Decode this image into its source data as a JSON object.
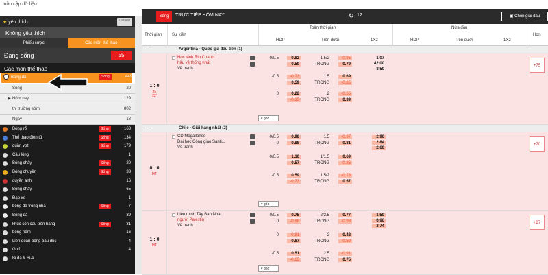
{
  "topbar": {
    "text": "luồn cập dữ liệu."
  },
  "sidebar": {
    "favorites": "yêu thích",
    "thong_button": "Thống kê",
    "no_favorites": "Không yêu thích",
    "tabs": [
      "Phiếu cược",
      "Các môn thể thao"
    ],
    "live_label": "Đang sống",
    "live_count": "55",
    "sports_header": "Các môn thể thao",
    "selected": {
      "label": "Bóng đá",
      "badge": "Sống",
      "count": "449"
    },
    "submenu": [
      {
        "label": "Sống",
        "count": "20"
      },
      {
        "label": "Hôm nay",
        "count": "129"
      },
      {
        "label": "thị trường sớm",
        "count": "802"
      },
      {
        "label": "Ngay",
        "count": "18"
      }
    ],
    "sports": [
      {
        "label": "Bóng rổ",
        "badge": "Sống",
        "count": "163",
        "color": "#e07b27"
      },
      {
        "label": "Thể thao điện tử",
        "badge": "Sống",
        "count": "134",
        "color": "#4a7bd6"
      },
      {
        "label": "quần vợt",
        "badge": "Sống",
        "count": "179",
        "color": "#c7d63a"
      },
      {
        "label": "Cầu lông",
        "badge": "",
        "count": "1",
        "color": "#ddd"
      },
      {
        "label": "Bóng chày",
        "badge": "Sống",
        "count": "20",
        "color": "#ddd"
      },
      {
        "label": "Bóng chuyền",
        "badge": "Sống",
        "count": "33",
        "color": "#e8b020"
      },
      {
        "label": "quyền anh",
        "badge": "",
        "count": "16",
        "color": "#c33"
      },
      {
        "label": "Bóng chày",
        "badge": "",
        "count": "65",
        "color": "#ddd"
      },
      {
        "label": "Đạp xe",
        "badge": "",
        "count": "1",
        "color": "#ddd"
      },
      {
        "label": "bóng đá trong nhà",
        "badge": "Sống",
        "count": "7",
        "color": "#eee"
      },
      {
        "label": "Bóng đá",
        "badge": "",
        "count": "39",
        "color": "#eee"
      },
      {
        "label": "khúc côn cầu trên băng",
        "badge": "Sống",
        "count": "31",
        "color": "#ddd"
      },
      {
        "label": "bóng ném",
        "badge": "",
        "count": "16",
        "color": "#ddd"
      },
      {
        "label": "Liên đoàn bóng bầu dục",
        "badge": "",
        "count": "4",
        "color": "#ddd"
      },
      {
        "label": "Golf",
        "badge": "",
        "count": "4",
        "color": "#ddd"
      },
      {
        "label": "Bi da & Bi-a",
        "badge": "",
        "count": "",
        "color": "#ddd"
      }
    ]
  },
  "main": {
    "header": {
      "live": "Sống",
      "title": "TRỰC TIẾP HÔM NAY",
      "count": "12",
      "pick": "Chọn giải đấu"
    },
    "columns": {
      "time": "Thời gian",
      "event": "Sự kiện",
      "full": "Toàn thời gian",
      "half": "Nửa đầu",
      "more": "Hơn",
      "hdp": "HDP",
      "ou": "Trên dưới",
      "x12": "1X2",
      "hdp2": "HDP",
      "ou2": "Trên dưới",
      "x122": "1X2"
    },
    "leagues": [
      {
        "name": "Argentina - Quốc gia đấu tiên (1)"
      },
      {
        "name": "Chile - Giải hạng nhất (2)"
      }
    ],
    "matches": [
      {
        "score": "1 : 0",
        "status": "2h",
        "status2": "22'",
        "home": "Học sinh Rio Cuarto",
        "away": "hậu vệ thống nhất",
        "draw": "Về tranh",
        "more": "+75",
        "goc": "góc",
        "rows": [
          {
            "hdp": "-0/0.5",
            "h1": "0.82",
            "h2": "0.59",
            "ou": "1.5/2",
            "ou2": "TRONG",
            "o1": "-0.95",
            "o2": "0.79",
            "x1": "1.07",
            "x2": "42.00",
            "x3": "8.50"
          },
          {
            "hdp": "-0.5",
            "h1": "-0.73",
            "h2": "0.59",
            "ou": "1.5",
            "ou2": "TRONG",
            "o1": "0.69",
            "o2": "-0.85"
          },
          {
            "hdp": "0",
            "h1": "0.22",
            "h2": "-0.35",
            "ou": "2",
            "ou2": "TRONG",
            "o1": "-0.55",
            "o2": "0.39"
          }
        ]
      },
      {
        "score": "0 : 0",
        "status": "HT",
        "status2": "",
        "home": "CD Magallanes",
        "away": "Đại học Công giáo Santi...",
        "draw": "Về tranh",
        "more": "+70",
        "goc": "góc",
        "rows": [
          {
            "hdp": "-0/0.5",
            "hdp_b": "0",
            "h1": "0.98",
            "h2": "0.88",
            "ou": "1.5",
            "ou2": "TRONG",
            "o1": "-0.97",
            "o2": "0.81",
            "x1": "2.96",
            "x2": "2.84",
            "x3": "2.60"
          },
          {
            "hdp": "-0/0.5",
            "h1": "1.10",
            "h2": "0.57",
            "ou": "1/1.5",
            "ou2": "TRONG",
            "o1": "0.69",
            "o2": "-0.85"
          },
          {
            "hdp": "-0.5",
            "h1": "0.59",
            "h2": "-0.73",
            "ou": "1.5/2",
            "ou2": "TRONG",
            "o1": "-0.73",
            "o2": "0.57"
          }
        ]
      },
      {
        "score": "1 : 0",
        "status": "HT",
        "status2": "",
        "home": "Liên minh Tây Ban Nha",
        "away": "người Palestin",
        "draw": "Về tranh",
        "more": "+87",
        "goc": "góc",
        "rows": [
          {
            "hdp": "-0/0.5",
            "hdp_b": "0",
            "h1": "0.75",
            "h2": "-0.88",
            "ou": "2/2.5",
            "ou2": "TRONG",
            "o1": "0.77",
            "o2": "-0.93",
            "x1": "1.50",
            "x2": "6.90",
            "x3": "3.74"
          },
          {
            "hdp": "0",
            "h1": "-0.81",
            "h2": "0.67",
            "ou": "2",
            "ou2": "TRONG",
            "o1": "0.42",
            "o2": "-0.50"
          },
          {
            "hdp": "-0.5",
            "h1": "0.51",
            "h2": "-0.65",
            "ou": "2.5",
            "ou2": "TRONG",
            "o1": "-0.91",
            "o2": "0.75"
          }
        ]
      }
    ]
  }
}
